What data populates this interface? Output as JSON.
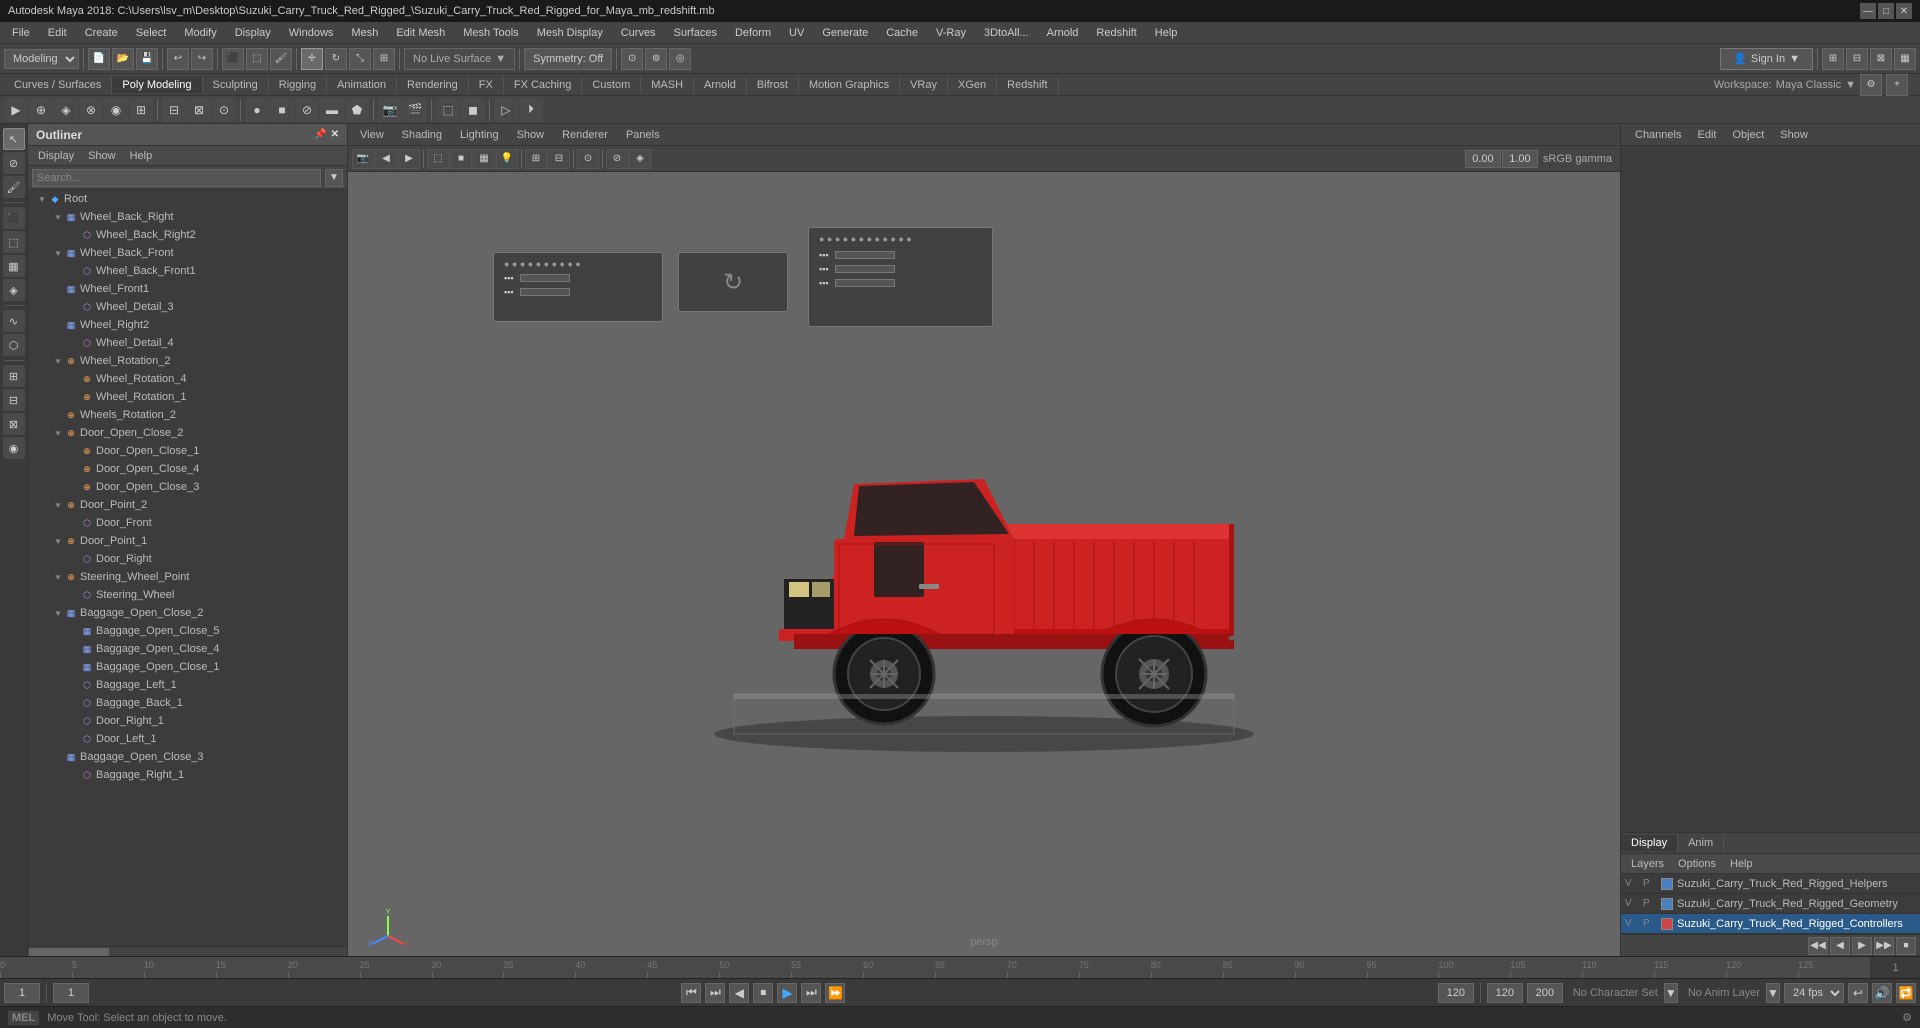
{
  "titleBar": {
    "title": "Autodesk Maya 2018: C:\\Users\\lsv_m\\Desktop\\Suzuki_Carry_Truck_Red_Rigged_\\Suzuki_Carry_Truck_Red_Rigged_for_Maya_mb_redshift.mb",
    "minimize": "—",
    "maximize": "□",
    "close": "✕"
  },
  "menuBar": {
    "items": [
      "File",
      "Edit",
      "Create",
      "Select",
      "Modify",
      "Display",
      "Windows",
      "Mesh",
      "Edit Mesh",
      "Mesh Tools",
      "Mesh Display",
      "Curves",
      "Surfaces",
      "Deform",
      "UV",
      "Generate",
      "Cache",
      "V-Ray",
      "3DtoAll...",
      "Arnold",
      "Redshift",
      "Help"
    ]
  },
  "toolbar1": {
    "workspaceDropdown": "Modeling",
    "noLiveSurface": "No Live Surface",
    "symmetryOff": "Symmetry: Off",
    "signIn": "Sign In"
  },
  "workspaceTabs": {
    "items": [
      "Curves / Surfaces",
      "Poly Modeling",
      "Sculpting",
      "Rigging",
      "Animation",
      "Rendering",
      "FX",
      "FX Caching",
      "Custom",
      "MASH",
      "Arnold",
      "Bifrost",
      "Motion Graphics",
      "VRay",
      "XGen",
      "Redshift"
    ],
    "active": "Poly Modeling",
    "workspace": "Workspace:",
    "workspaceValue": "Maya Classic"
  },
  "outliner": {
    "title": "Outliner",
    "menuItems": [
      "Display",
      "Show",
      "Help"
    ],
    "search": {
      "placeholder": "Search...",
      "dropdownLabel": "▼"
    },
    "tree": [
      {
        "label": "Root",
        "level": 0,
        "type": "root",
        "expanded": true
      },
      {
        "label": "Wheel_Back_Right",
        "level": 1,
        "type": "group",
        "expanded": true
      },
      {
        "label": "Wheel_Back_Right2",
        "level": 2,
        "type": "mesh"
      },
      {
        "label": "Wheel_Back_Front",
        "level": 1,
        "type": "group",
        "expanded": true
      },
      {
        "label": "Wheel_Back_Front1",
        "level": 2,
        "type": "mesh"
      },
      {
        "label": "Wheel_Front1",
        "level": 1,
        "type": "group"
      },
      {
        "label": "Wheel_Detail_3",
        "level": 2,
        "type": "mesh"
      },
      {
        "label": "Wheel_Right2",
        "level": 1,
        "type": "group"
      },
      {
        "label": "Wheel_Detail_4",
        "level": 2,
        "type": "mesh"
      },
      {
        "label": "Wheel_Rotation_2",
        "level": 1,
        "type": "joint",
        "expanded": true
      },
      {
        "label": "Wheel_Rotation_4",
        "level": 2,
        "type": "joint"
      },
      {
        "label": "Wheel_Rotation_1",
        "level": 2,
        "type": "joint"
      },
      {
        "label": "Wheels_Rotation_2",
        "level": 1,
        "type": "joint"
      },
      {
        "label": "Door_Open_Close_2",
        "level": 1,
        "type": "joint",
        "expanded": true
      },
      {
        "label": "Door_Open_Close_1",
        "level": 2,
        "type": "joint"
      },
      {
        "label": "Door_Open_Close_4",
        "level": 2,
        "type": "joint"
      },
      {
        "label": "Door_Open_Close_3",
        "level": 2,
        "type": "joint"
      },
      {
        "label": "Door_Point_2",
        "level": 1,
        "type": "joint",
        "expanded": true
      },
      {
        "label": "Door_Front",
        "level": 2,
        "type": "mesh"
      },
      {
        "label": "Door_Point_1",
        "level": 1,
        "type": "joint",
        "expanded": true
      },
      {
        "label": "Door_Right",
        "level": 2,
        "type": "mesh"
      },
      {
        "label": "Steering_Wheel_Point",
        "level": 1,
        "type": "joint",
        "expanded": true
      },
      {
        "label": "Steering_Wheel",
        "level": 2,
        "type": "mesh"
      },
      {
        "label": "Baggage_Open_Close_2",
        "level": 1,
        "type": "group",
        "expanded": true
      },
      {
        "label": "Baggage_Open_Close_5",
        "level": 2,
        "type": "group"
      },
      {
        "label": "Baggage_Open_Close_4",
        "level": 2,
        "type": "group"
      },
      {
        "label": "Baggage_Open_Close_1",
        "level": 2,
        "type": "group"
      },
      {
        "label": "Baggage_Left_1",
        "level": 2,
        "type": "mesh"
      },
      {
        "label": "Baggage_Back_1",
        "level": 2,
        "type": "mesh"
      },
      {
        "label": "Door_Right_1",
        "level": 2,
        "type": "mesh"
      },
      {
        "label": "Door_Left_1",
        "level": 2,
        "type": "mesh"
      },
      {
        "label": "Baggage_Open_Close_3",
        "level": 1,
        "type": "group"
      },
      {
        "label": "Baggage_Right_1",
        "level": 2,
        "type": "mesh"
      }
    ]
  },
  "viewport": {
    "menuItems": [
      "View",
      "Shading",
      "Lighting",
      "Show",
      "Renderer",
      "Panels"
    ],
    "perspLabel": "persp",
    "gamma": "sRGB gamma",
    "valueA": "0.00",
    "valueB": "1.00"
  },
  "channels": {
    "menuItems": [
      "Channels",
      "Edit",
      "Object",
      "Show"
    ],
    "displayTab": "Display",
    "animTab": "Anim",
    "layerMenuItems": [
      "Layers",
      "Options",
      "Help"
    ],
    "layers": [
      {
        "v": "V",
        "p": "P",
        "color": "#4a7fc1",
        "name": "Suzuki_Carry_Truck_Red_Rigged_Helpers",
        "selected": false
      },
      {
        "v": "V",
        "p": "P",
        "color": "#4a7fc1",
        "name": "Suzuki_Carry_Truck_Red_Rigged_Geometry",
        "selected": false
      },
      {
        "v": "V",
        "p": "P",
        "color": "#cc4444",
        "name": "Suzuki_Carry_Truck_Red_Rigged_Controllers",
        "selected": true
      }
    ],
    "rightBtns": [
      "◀◀",
      "◀",
      "▶",
      "▶▶",
      "⏹"
    ]
  },
  "timeline": {
    "start": 0,
    "end": 100,
    "marks": [
      0,
      5,
      10,
      15,
      20,
      25,
      30,
      35,
      40,
      45,
      50,
      55,
      60,
      65,
      70,
      75,
      80,
      85,
      90,
      95,
      100,
      105,
      110,
      115,
      120,
      125
    ],
    "rightValue": "1"
  },
  "transport": {
    "frameStart": "1",
    "frameEnd": "1",
    "playbackStart": "120",
    "playbackEnd": "120",
    "animEnd": "200",
    "noCharacter": "No Character Set",
    "noAnimLayer": "No Anim Layer",
    "fps": "24 fps",
    "btns": [
      "⏮",
      "⏭",
      "◀",
      "⏹",
      "▶",
      "⏭",
      "⏩"
    ]
  },
  "statusBar": {
    "lang": "MEL",
    "message": "Move Tool: Select an object to move.",
    "right": ""
  }
}
